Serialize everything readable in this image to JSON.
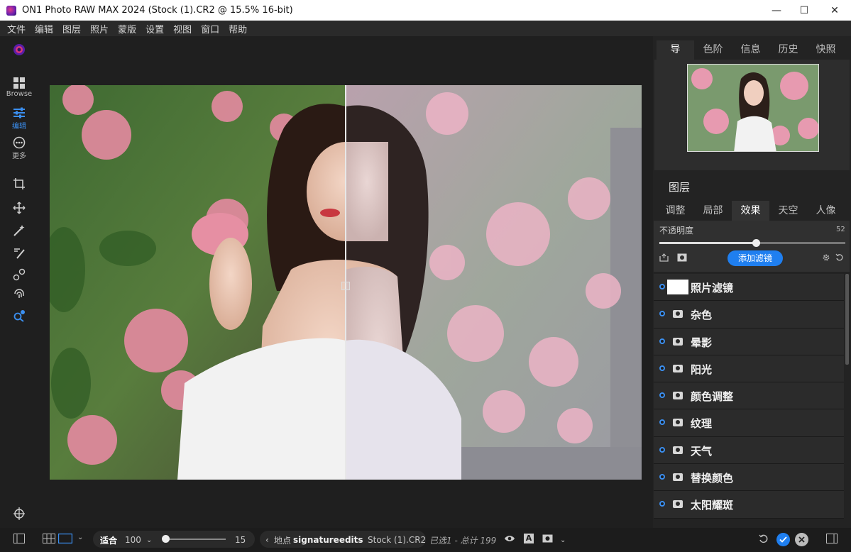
{
  "window": {
    "title": "ON1 Photo RAW MAX 2024 (Stock (1).CR2 @ 15.5% 16-bit)",
    "minimize": "—",
    "maximize": "☐",
    "close": "✕"
  },
  "menu": [
    "文件",
    "编辑",
    "图层",
    "照片",
    "蒙版",
    "设置",
    "视图",
    "窗口",
    "帮助"
  ],
  "leftbar": {
    "browse_label": "Browse",
    "edit_label": "编辑",
    "more_label": "更多"
  },
  "right_tabs": [
    "导",
    "色阶",
    "信息",
    "历史",
    "快照"
  ],
  "layers": {
    "title": "图层",
    "subtabs": [
      "调整",
      "局部",
      "效果",
      "天空",
      "人像"
    ],
    "opacity_label": "不透明度",
    "opacity_value": "52",
    "opacity_fraction": 0.52,
    "add_filter": "添加滤镜",
    "filters": [
      "照片滤镜",
      "杂色",
      "晕影",
      "阳光",
      "颜色调整",
      "纹理",
      "天气",
      "替换颜色",
      "太阳耀斑"
    ]
  },
  "bottom": {
    "fit_label": "适合",
    "zoom_value": "100",
    "zoom_fraction": 0.04,
    "slider_value": "15",
    "breadcrumb_prefix": "地点",
    "breadcrumb_folder": "signatureedits",
    "file_name": "Stock (1).CR2",
    "selection_info": "已选1 - 总计 199",
    "text_icon_glyph": "A"
  },
  "colors": {
    "accent": "#1f7ff0",
    "panel": "#232323"
  }
}
